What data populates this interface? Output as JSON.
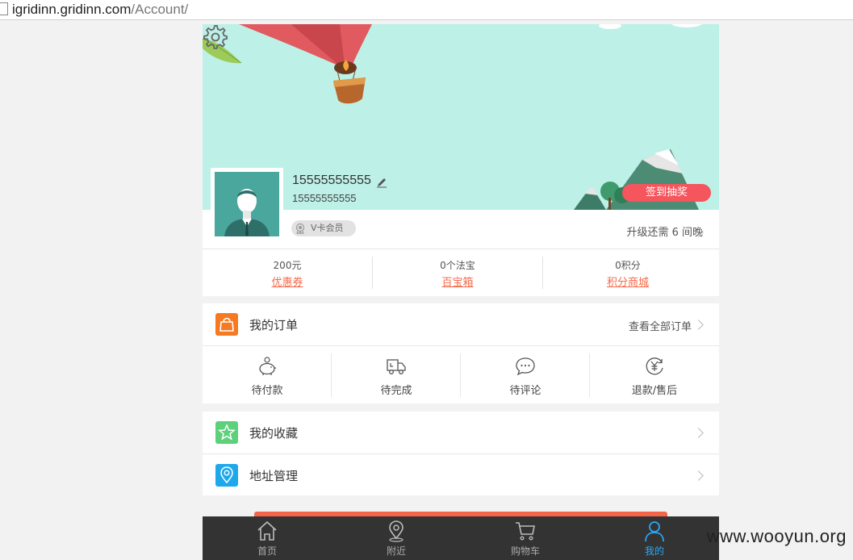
{
  "browser": {
    "url_host": "igridinn.gridinn.com",
    "url_path": "/Account/"
  },
  "profile": {
    "name": "15555555555",
    "phone": "15555555555",
    "vip_label": "V卡会员",
    "checkin_label": "签到抽奖",
    "upgrade_text": "升级还需 6 间晚"
  },
  "stats": [
    {
      "value": "200元",
      "label": "优惠券"
    },
    {
      "value": "0个法宝",
      "label": "百宝箱"
    },
    {
      "value": "0积分",
      "label": "积分商城"
    }
  ],
  "orders": {
    "title": "我的订单",
    "view_all": "查看全部订单",
    "items": [
      {
        "label": "待付款",
        "icon": "piggy-bank-icon"
      },
      {
        "label": "待完成",
        "icon": "delivery-truck-icon"
      },
      {
        "label": "待评论",
        "icon": "chat-bubble-icon"
      },
      {
        "label": "退款/售后",
        "icon": "yuan-refund-icon"
      }
    ]
  },
  "menu": [
    {
      "label": "我的收藏",
      "icon": "star-icon"
    },
    {
      "label": "地址管理",
      "icon": "location-pin-icon"
    }
  ],
  "tabbar": [
    {
      "label": "首页",
      "icon": "home-icon"
    },
    {
      "label": "附近",
      "icon": "map-pin-icon"
    },
    {
      "label": "购物车",
      "icon": "cart-icon"
    },
    {
      "label": "我的",
      "icon": "user-icon",
      "active": true
    }
  ],
  "watermark": "www.wooyun.org",
  "colors": {
    "banner": "#bdf0e7",
    "accent_red": "#f5555c",
    "link_orange": "#f56a4a",
    "active_tab": "#2aa7f5",
    "tabbar": "#333333"
  }
}
